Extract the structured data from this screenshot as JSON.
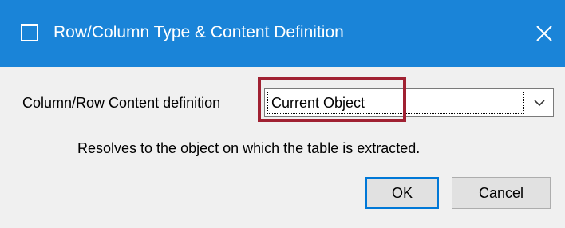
{
  "window": {
    "title": "Row/Column Type & Content Definition",
    "titlebar_color": "#1a84d8",
    "app_icon": "window-square-icon",
    "close_icon": "close-icon"
  },
  "form": {
    "content_definition_label": "Column/Row Content definition",
    "content_definition_value": "Current Object",
    "dropdown_icon": "chevron-down-icon",
    "description": "Resolves to the object on which the table is extracted.",
    "highlight_color": "#a02132"
  },
  "buttons": {
    "ok_label": "OK",
    "cancel_label": "Cancel"
  }
}
